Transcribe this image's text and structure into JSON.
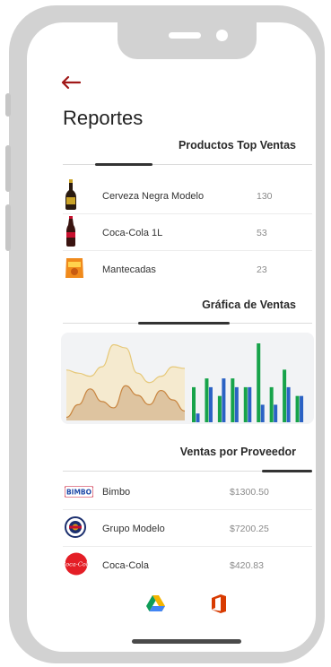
{
  "header": {
    "back_icon": "arrow-left-icon",
    "title": "Reportes"
  },
  "top_products": {
    "title": "Productos Top Ventas",
    "items": [
      {
        "icon": "beer-bottle-icon",
        "name": "Cerveza Negra Modelo",
        "value": "130"
      },
      {
        "icon": "cola-bottle-icon",
        "name": "Coca-Cola 1L",
        "value": "53"
      },
      {
        "icon": "snack-bag-icon",
        "name": "Mantecadas",
        "value": "23"
      }
    ]
  },
  "sales_chart": {
    "title": "Gráfica de Ventas"
  },
  "chart_data": [
    {
      "type": "area",
      "series": [
        {
          "values": [
            3.2,
            3.0,
            2.8,
            3.4,
            4.8,
            4.6,
            3.0,
            2.4,
            2.8,
            3.4,
            3.3
          ]
        },
        {
          "values": [
            0.2,
            1.0,
            2.0,
            1.2,
            0.8,
            2.2,
            1.6,
            1.0,
            1.9,
            1.3,
            0.6
          ]
        }
      ],
      "colors": [
        "#f4e9cc",
        "#dcc09a"
      ]
    },
    {
      "type": "bar",
      "series": [
        {
          "values": [
            4,
            5,
            3,
            5,
            4,
            9,
            4,
            6,
            3
          ]
        },
        {
          "values": [
            1,
            4,
            5,
            4,
            4,
            2,
            2,
            4,
            3
          ]
        }
      ],
      "colors": [
        "#17a34a",
        "#2b62c4"
      ]
    }
  ],
  "suppliers": {
    "title": "Ventas por Proveedor",
    "items": [
      {
        "icon": "bimbo-logo-icon",
        "logo_text": "BIMBO",
        "name": "Bimbo",
        "value": "$1300.50"
      },
      {
        "icon": "grupo-modelo-logo-icon",
        "name": "Grupo Modelo",
        "value": "$7200.25"
      },
      {
        "icon": "coca-cola-logo-icon",
        "logo_text": "Coca-Cola",
        "name": "Coca-Cola",
        "value": "$420.83"
      }
    ]
  },
  "footer_apps": [
    {
      "icon": "google-drive-icon"
    },
    {
      "icon": "office-icon"
    }
  ],
  "colors": {
    "accent": "#a01818",
    "frame": "#d2d2d2",
    "bar_green": "#17a34a",
    "bar_blue": "#2b62c4"
  }
}
